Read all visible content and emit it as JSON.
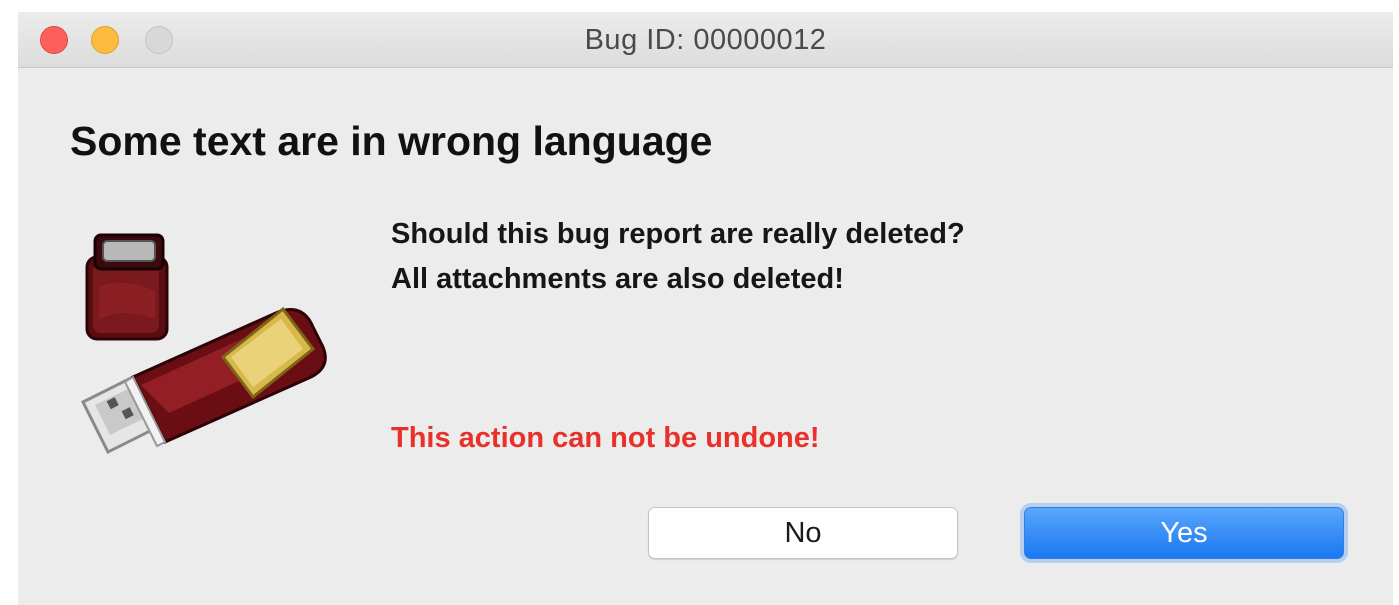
{
  "window": {
    "title": "Bug ID: 00000012",
    "traffic_lights": {
      "close_color": "#fc605c",
      "minimize_color": "#fdbc40",
      "zoom_color": "#d8d8d8"
    }
  },
  "dialog": {
    "heading": "Some text are in wrong language",
    "icon": "usb-dongle-icon",
    "message_lines": [
      "Should this bug report are really deleted?",
      "All attachments are also deleted!"
    ],
    "warning": "This action can not be undone!",
    "warning_color": "#e8312a",
    "buttons": {
      "no_label": "No",
      "yes_label": "Yes"
    },
    "accent_color": "#1a78f0"
  }
}
